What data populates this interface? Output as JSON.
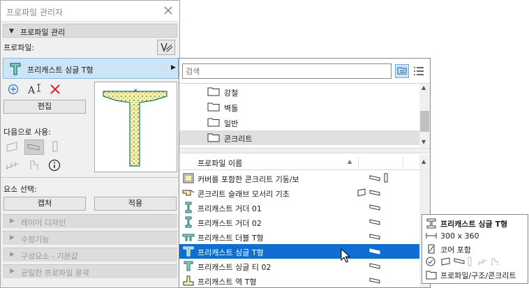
{
  "window": {
    "title": "프로파일 관리자"
  },
  "section_profile": {
    "label": "프로파일 관리"
  },
  "profile_label": "프로파일:",
  "selected_profile": {
    "name": "프리캐스트 싱글 T형"
  },
  "edit_button": "편집",
  "use_as_label": "다음으로 사용:",
  "element_select_label": "요소 선택:",
  "capture_button": "캡처",
  "apply_button": "적용",
  "collapsed_sections": [
    {
      "label": "레이어 디자인"
    },
    {
      "label": "수정기능"
    },
    {
      "label": "구성요소 - 기본값"
    },
    {
      "label": "균일한 프로파일 윤곽"
    }
  ],
  "popup": {
    "search_placeholder": "검색",
    "folders": [
      {
        "label": "강철"
      },
      {
        "label": "벽돌"
      },
      {
        "label": "일반"
      },
      {
        "label": "콘크리트",
        "selected": true
      }
    ],
    "list_header": "프로파일 이름",
    "items": [
      {
        "label": "커버를 포함한 콘크리트 기둥/보",
        "icon": "column-hatch-icon"
      },
      {
        "label": "콘크리트 슬래브 모서리 기초",
        "icon": "slab-edge-icon"
      },
      {
        "label": "프리캐스트 거더 01",
        "icon": "girder-icon"
      },
      {
        "label": "프리캐스트 거더 02",
        "icon": "girder-icon"
      },
      {
        "label": "프리캐스트 더블 T형",
        "icon": "double-t-icon"
      },
      {
        "label": "프리캐스트 싱글 T형",
        "icon": "single-t-icon",
        "selected": true
      },
      {
        "label": "프리캐스트 싱글 티 02",
        "icon": "single-t-icon"
      },
      {
        "label": "프리캐스트 역 T형",
        "icon": "inverted-t-icon"
      }
    ]
  },
  "tooltip": {
    "name": "프리캐스트 싱글 T형",
    "size": "300 x 360",
    "core": "코어 포함",
    "path": "프로파일/구조/콘크리트"
  },
  "colors": {
    "selection": "#0f6fd0",
    "accent_teal": "#1a8c8c",
    "hatch": "#c8b94a",
    "delete_red": "#e02020",
    "add_blue": "#2a6fd6"
  }
}
